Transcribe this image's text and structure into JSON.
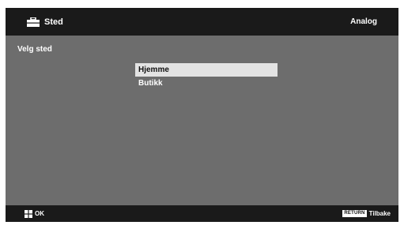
{
  "header": {
    "title": "Sted",
    "icon": "toolbox-icon",
    "mode": "Analog"
  },
  "content": {
    "label": "Velg sted",
    "options": [
      {
        "label": "Hjemme",
        "selected": true
      },
      {
        "label": "Butikk",
        "selected": false
      }
    ]
  },
  "footer": {
    "ok_icon": "four-squares-icon",
    "ok_label": "OK",
    "return_badge": "RETURN",
    "back_label": "Tilbake"
  },
  "colors": {
    "background": "#6d6d6d",
    "bars": "#1a1a1a",
    "selection": "#e3e3e3"
  }
}
